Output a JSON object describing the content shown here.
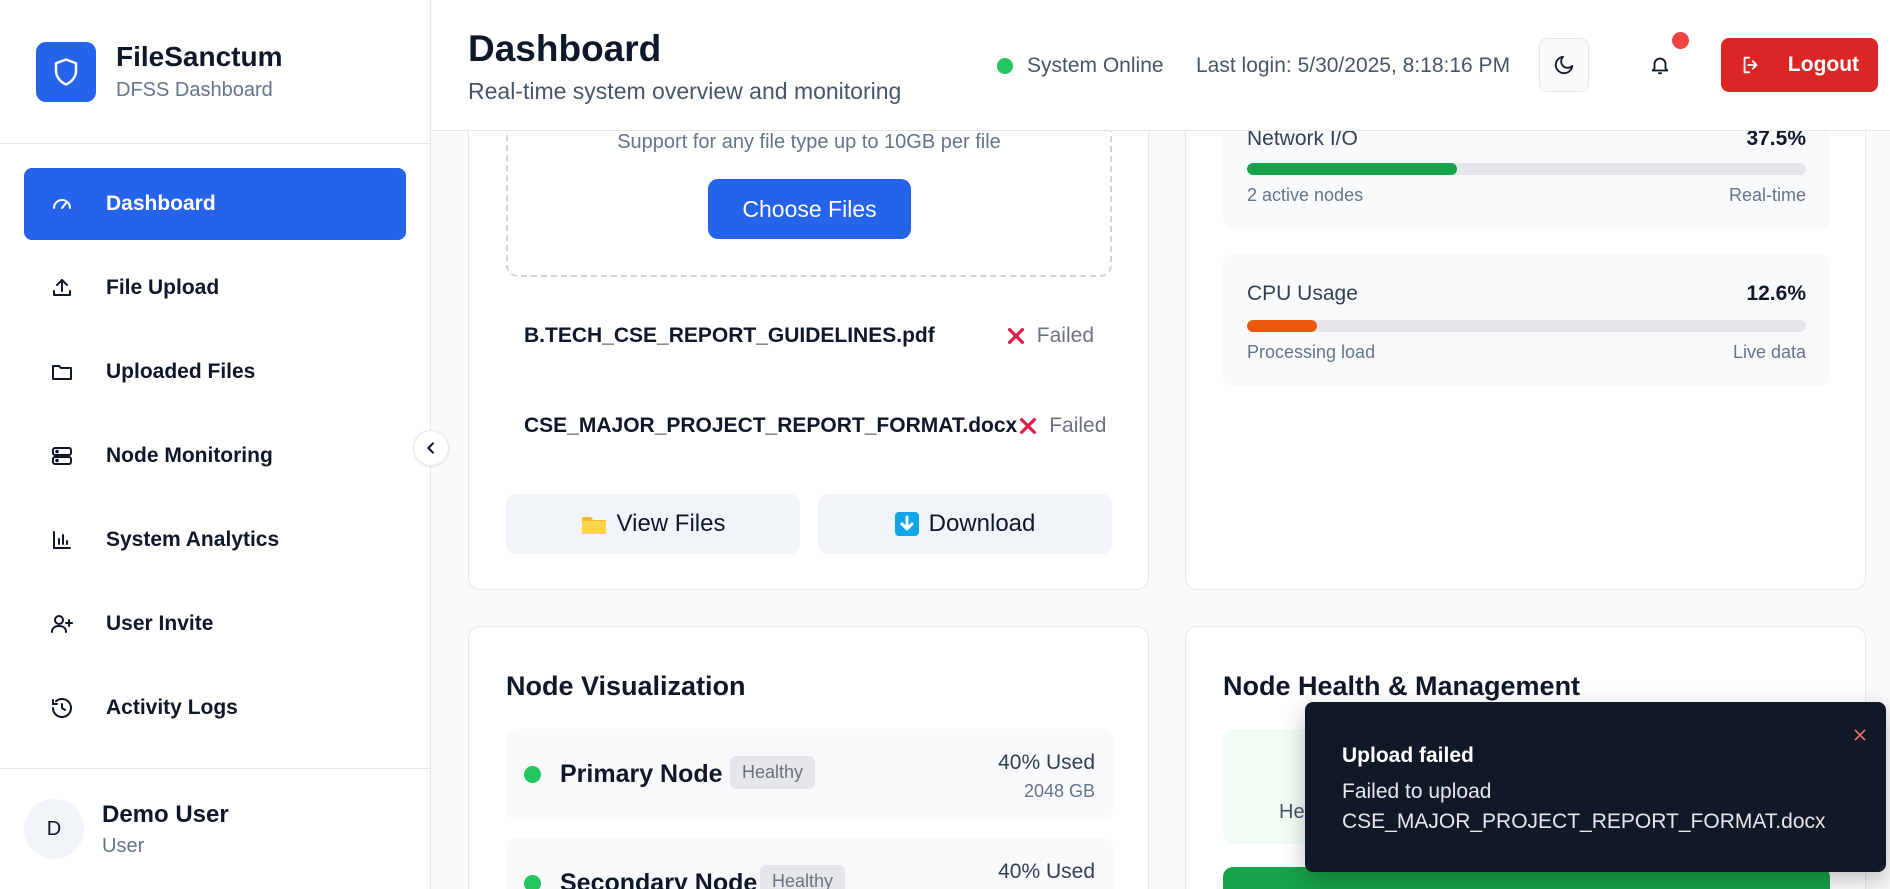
{
  "brand": {
    "title": "FileSanctum",
    "subtitle": "DFSS Dashboard"
  },
  "sidebar": {
    "items": [
      {
        "label": "Dashboard",
        "icon": "gauge-icon",
        "active": true
      },
      {
        "label": "File Upload",
        "icon": "upload-icon"
      },
      {
        "label": "Uploaded Files",
        "icon": "folder-icon"
      },
      {
        "label": "Node Monitoring",
        "icon": "server-icon"
      },
      {
        "label": "System Analytics",
        "icon": "bar-chart-icon"
      },
      {
        "label": "User Invite",
        "icon": "user-plus-icon"
      },
      {
        "label": "Activity Logs",
        "icon": "history-icon"
      }
    ]
  },
  "user": {
    "initial": "D",
    "name": "Demo User",
    "role": "User"
  },
  "header": {
    "title": "Dashboard",
    "subtitle": "Real-time system overview and monitoring",
    "status": "System Online",
    "last_login": "Last login: 5/30/2025, 8:18:16 PM",
    "logout_label": "Logout"
  },
  "upload": {
    "support_text": "Support for any file type up to 10GB per file",
    "choose_label": "Choose Files",
    "files": [
      {
        "name": "B.TECH_CSE_REPORT_GUIDELINES.pdf",
        "status": "Failed"
      },
      {
        "name": "CSE_MAJOR_PROJECT_REPORT_FORMAT.docx",
        "status": "Failed"
      }
    ],
    "view_files_label": "View Files",
    "download_label": "Download"
  },
  "metrics": [
    {
      "label": "Network I/O",
      "value": "37.5%",
      "percent": 37.5,
      "color": "#16a34a",
      "foot_left": "2 active nodes",
      "foot_right": "Real-time"
    },
    {
      "label": "CPU Usage",
      "value": "12.6%",
      "percent": 12.6,
      "color": "#ea580c",
      "foot_left": "Processing load",
      "foot_right": "Live data"
    }
  ],
  "nodes": {
    "title": "Node Visualization",
    "items": [
      {
        "name": "Primary Node",
        "badge": "Healthy",
        "used": "40% Used",
        "capacity": "2048 GB"
      },
      {
        "name": "Secondary Node",
        "badge": "Healthy",
        "used": "40% Used"
      }
    ]
  },
  "health": {
    "title": "Node Health & Management",
    "tile_text": "He"
  },
  "toast": {
    "title": "Upload failed",
    "message": "Failed to upload CSE_MAJOR_PROJECT_REPORT_FORMAT.docx"
  },
  "colors": {
    "accent": "#2563eb",
    "danger": "#dc2626",
    "success": "#22c55e"
  }
}
